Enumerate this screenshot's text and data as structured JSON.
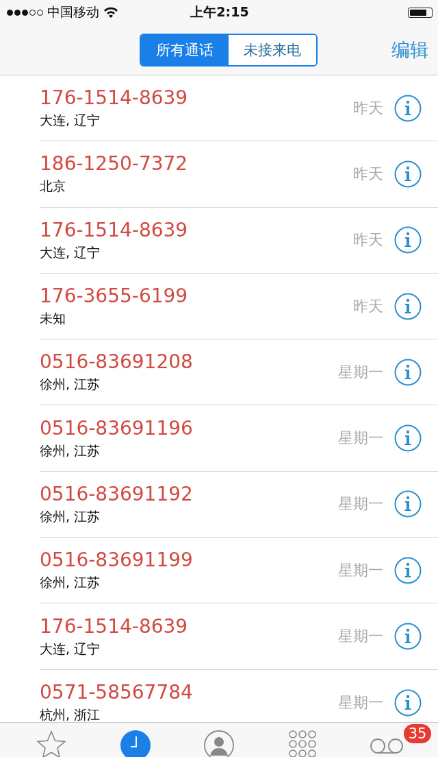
{
  "status_bar": {
    "carrier": "中国移动",
    "time": "上午2:15"
  },
  "nav": {
    "segments": [
      {
        "label": "所有通话",
        "selected": true
      },
      {
        "label": "未接来电",
        "selected": false
      }
    ],
    "edit": "编辑"
  },
  "calls": [
    {
      "number": "176-1514-8639",
      "location": "大连, 辽宁",
      "date": "昨天"
    },
    {
      "number": "186-1250-7372",
      "location": "北京",
      "date": "昨天"
    },
    {
      "number": "176-1514-8639",
      "location": "大连, 辽宁",
      "date": "昨天"
    },
    {
      "number": "176-3655-6199",
      "location": "未知",
      "date": "昨天"
    },
    {
      "number": "0516-83691208",
      "location": "徐州, 江苏",
      "date": "星期一"
    },
    {
      "number": "0516-83691196",
      "location": "徐州, 江苏",
      "date": "星期一"
    },
    {
      "number": "0516-83691192",
      "location": "徐州, 江苏",
      "date": "星期一"
    },
    {
      "number": "0516-83691199",
      "location": "徐州, 江苏",
      "date": "星期一"
    },
    {
      "number": "176-1514-8639",
      "location": "大连, 辽宁",
      "date": "星期一"
    },
    {
      "number": "0571-58567784",
      "location": "杭州, 浙江",
      "date": "星期一"
    }
  ],
  "tab_bar": {
    "tabs": [
      {
        "kind": "favorites",
        "selected": false
      },
      {
        "kind": "recents",
        "selected": true
      },
      {
        "kind": "contacts",
        "selected": false
      },
      {
        "kind": "keypad",
        "selected": false
      },
      {
        "kind": "voicemail",
        "selected": false,
        "badge": "35"
      }
    ]
  }
}
